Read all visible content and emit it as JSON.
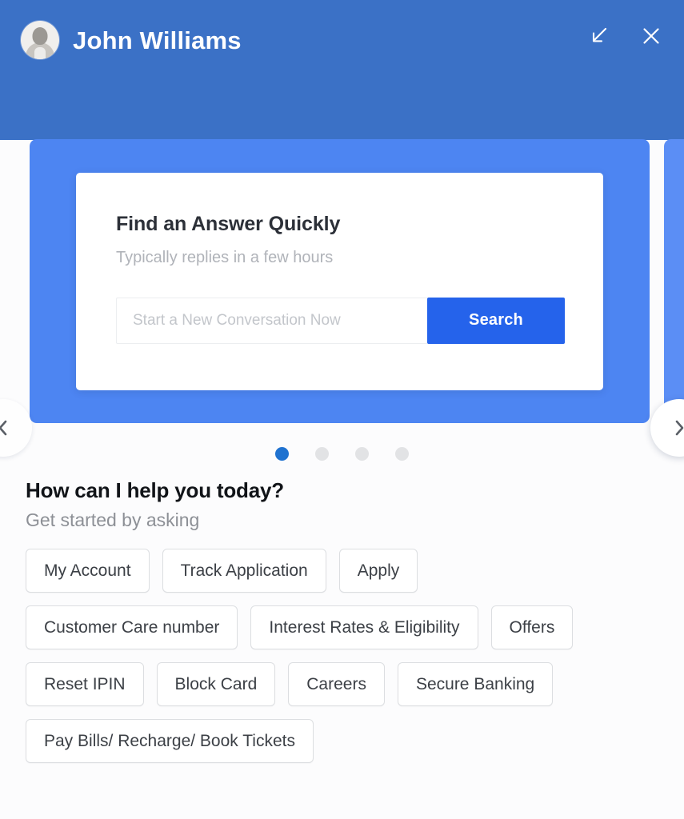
{
  "header": {
    "user_name": "John Williams",
    "avatar_icon": "user-avatar-photo",
    "minimize_icon": "arrow-down-left-icon",
    "close_icon": "close-x-icon",
    "background_color": "#3b71c6"
  },
  "carousel": {
    "prev_icon": "chevron-left-icon",
    "next_icon": "chevron-right-icon",
    "slide_color": "#4d85f2",
    "next_slide_color": "#5b8ef5",
    "active_index": 0,
    "dots": [
      {
        "active": true
      },
      {
        "active": false
      },
      {
        "active": false
      },
      {
        "active": false
      }
    ],
    "slide": {
      "title": "Find an Answer Quickly",
      "subtitle": "Typically replies in a few hours",
      "search_placeholder": "Start a New Conversation Now",
      "search_value": "",
      "search_button": "Search",
      "search_button_color": "#2563eb"
    }
  },
  "prompts": {
    "title": "How can I help you today?",
    "subtitle": "Get started by asking",
    "rows": [
      [
        "My Account",
        "Track Application",
        "Apply"
      ],
      [
        "Customer Care number",
        "Interest Rates & Eligibility",
        "Offers"
      ],
      [
        "Reset IPIN",
        "Block Card",
        "Careers",
        "Secure Banking"
      ],
      [
        "Pay Bills/ Recharge/ Book Tickets"
      ]
    ]
  }
}
